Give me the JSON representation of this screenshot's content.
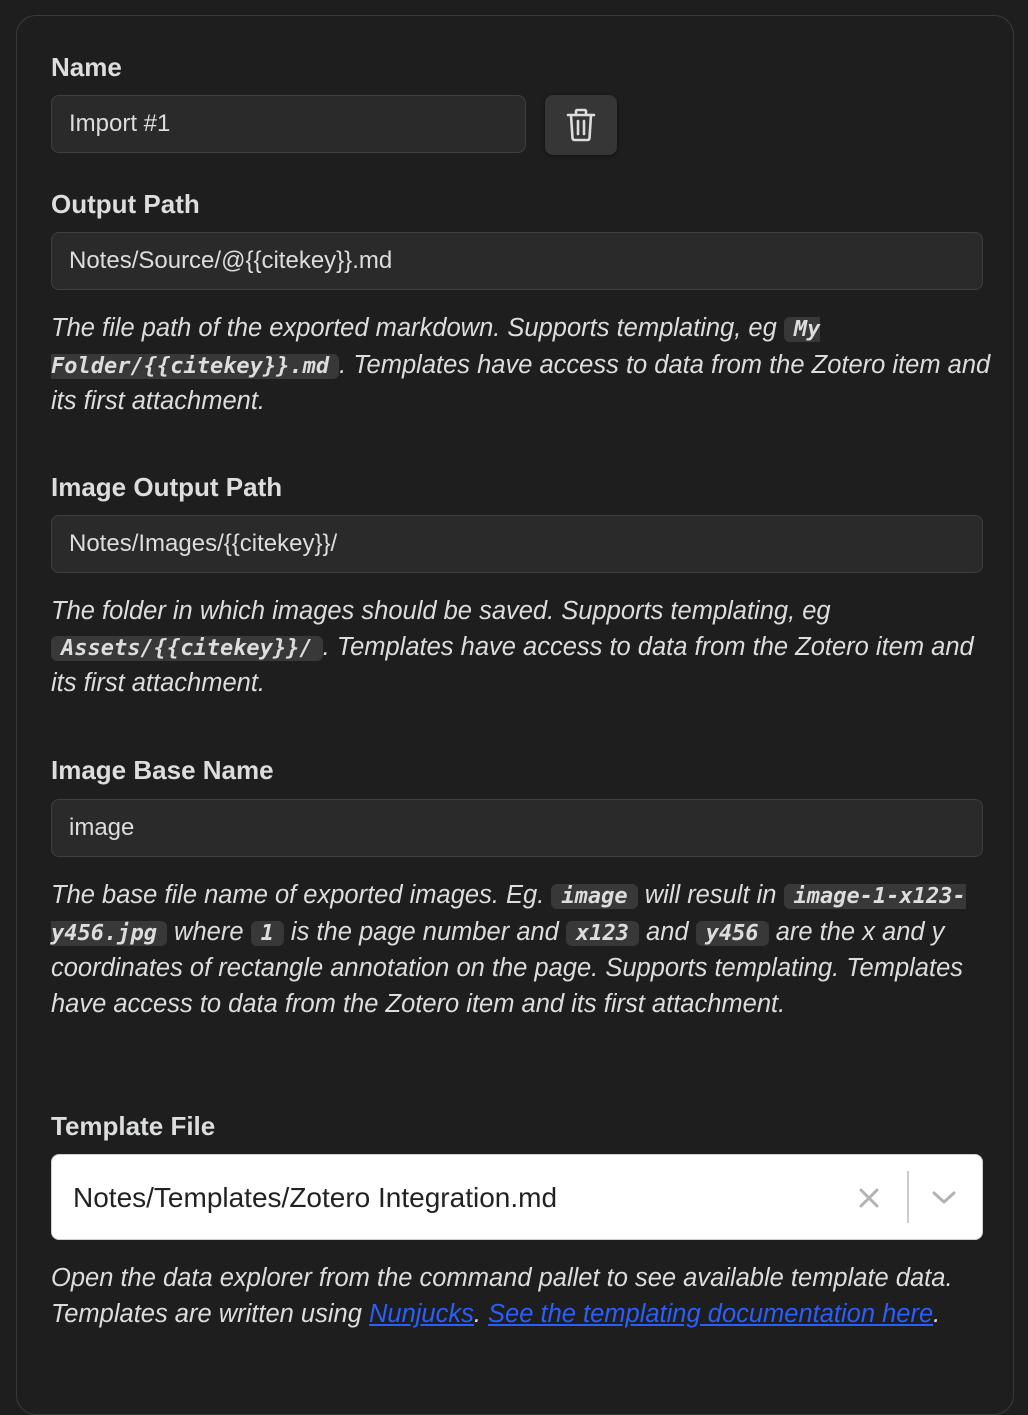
{
  "name_section": {
    "label": "Name",
    "value": "Import #1",
    "delete_icon": "trash-icon"
  },
  "output_path": {
    "label": "Output Path",
    "value": "Notes/Source/@{{citekey}}.md",
    "desc_1": "The file path of the exported markdown. Supports templating, eg ",
    "desc_code": "My Folder/{{citekey}}.md",
    "desc_2": ". Templates have access to data from the Zotero item and its first attachment."
  },
  "image_output_path": {
    "label": "Image Output Path",
    "value": "Notes/Images/{{citekey}}/",
    "desc_1": "The folder in which images should be saved. Supports templating, eg ",
    "desc_code": "Assets/{{citekey}}/",
    "desc_2": ". Templates have access to data from the Zotero item and its first attachment."
  },
  "image_base_name": {
    "label": "Image Base Name",
    "value": "image",
    "desc_1": "The base file name of exported images. Eg. ",
    "code_1": "image",
    "desc_2": " will result in ",
    "code_2": "image-1-x123-y456.jpg",
    "desc_3": " where ",
    "code_3": "1",
    "desc_4": " is the page number and ",
    "code_4": "x123",
    "desc_5": " and ",
    "code_5": "y456",
    "desc_6": " are the x and y coordinates of rectangle annotation on the page. Supports templating. Templates have access to data from the Zotero item and its first attachment."
  },
  "template_file": {
    "label": "Template File",
    "value": "Notes/Templates/Zotero Integration.md",
    "clear_icon": "close-icon",
    "dropdown_icon": "chevron-down-icon",
    "desc_1": "Open the data explorer from the command pallet to see available template data. Templates are written using ",
    "link_1": "Nunjucks",
    "desc_2": ". ",
    "link_2": "See the templating documentation here",
    "desc_3": "."
  },
  "colors": {
    "background": "#1e1e1e",
    "input_background": "#2a2a2a",
    "code_background": "#383838",
    "link": "#2a5ffd",
    "text": "#dcddde"
  }
}
